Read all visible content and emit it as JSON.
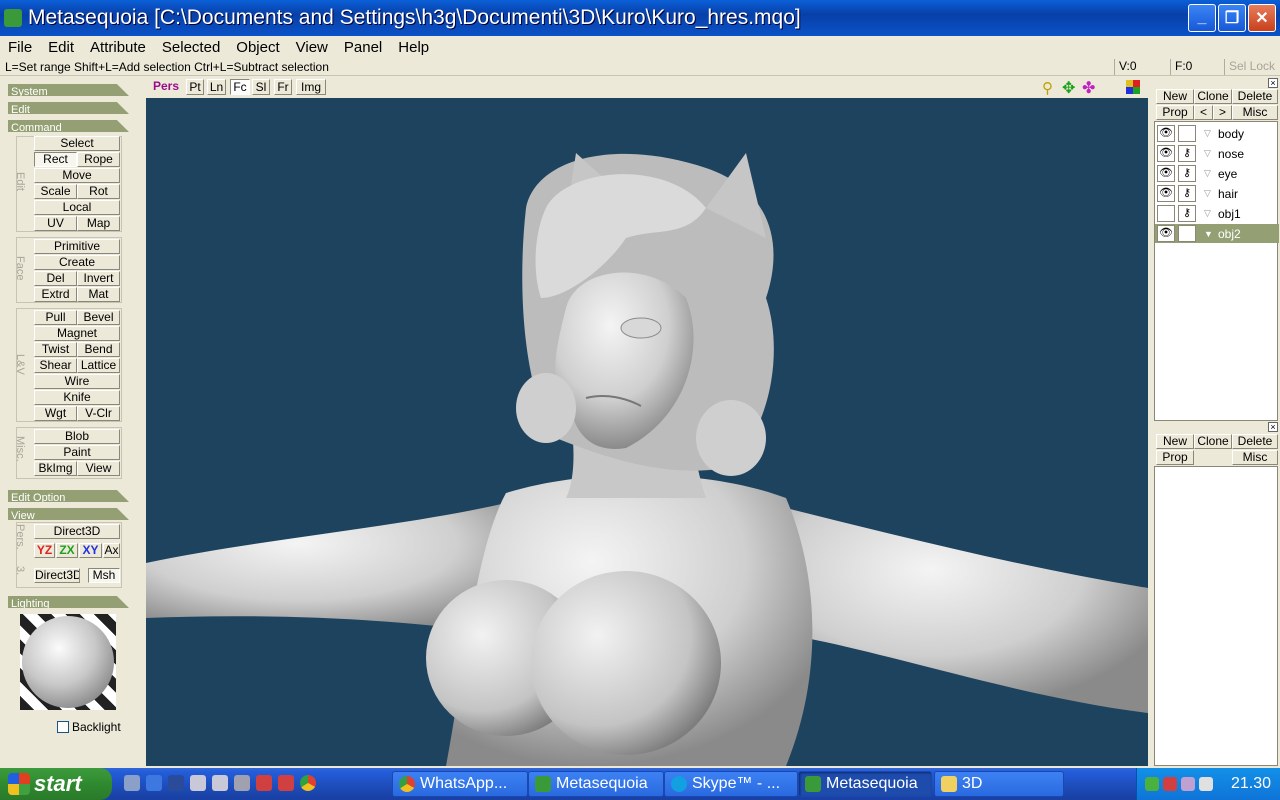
{
  "window": {
    "title": "Metasequoia [C:\\Documents and Settings\\h3g\\Documenti\\3D\\Kuro\\Kuro_hres.mqo]",
    "minimize": "_",
    "maximize": "❐",
    "close": "✕"
  },
  "menu": [
    "File",
    "Edit",
    "Attribute",
    "Selected",
    "Object",
    "View",
    "Panel",
    "Help"
  ],
  "status": {
    "hint": "L=Set range  Shift+L=Add selection  Ctrl+L=Subtract selection",
    "v": "V:0",
    "f": "F:0",
    "sel_lock": "Sel Lock"
  },
  "left": {
    "sections": {
      "system": "System",
      "edit": "Edit",
      "command": "Command",
      "edit_option": "Edit Option",
      "view": "View",
      "lighting": "Lighting"
    },
    "group_labels": {
      "edit": "Edit",
      "face": "Face",
      "lv": "L&V",
      "misc": "Misc.",
      "pers": "Pers.",
      "three": "3."
    },
    "buttons": {
      "select": "Select",
      "rect": "Rect",
      "rope": "Rope",
      "move": "Move",
      "scale": "Scale",
      "rot": "Rot",
      "local": "Local",
      "uv": "UV",
      "map": "Map",
      "primitive": "Primitive",
      "create": "Create",
      "del": "Del",
      "invert": "Invert",
      "extrd": "Extrd",
      "mat": "Mat",
      "pull": "Pull",
      "bevel": "Bevel",
      "magnet": "Magnet",
      "twist": "Twist",
      "bend": "Bend",
      "shear": "Shear",
      "lattice": "Lattice",
      "wire": "Wire",
      "knife": "Knife",
      "wgt": "Wgt",
      "vclr": "V-Clr",
      "blob": "Blob",
      "paint": "Paint",
      "bkimg": "BkImg",
      "view": "View",
      "direct3d": "Direct3D",
      "yz": "YZ",
      "zx": "ZX",
      "xy": "XY",
      "ax": "Ax",
      "direct3d2": "Direct3D",
      "msh": "Msh"
    },
    "backlight": "Backlight"
  },
  "viewport": {
    "buttons": [
      "Pers",
      "Pt",
      "Ln",
      "Fc",
      "Sl",
      "Fr",
      "Img"
    ],
    "active": "Fc",
    "background": "#1e435e"
  },
  "right": {
    "object_buttons": {
      "new": "New",
      "clone": "Clone",
      "delete": "Delete",
      "prop": "Prop",
      "prev": "<",
      "next": ">",
      "misc": "Misc"
    },
    "objects": [
      {
        "name": "body",
        "visible": true,
        "locked": false,
        "selected": false
      },
      {
        "name": "nose",
        "visible": true,
        "locked": true,
        "selected": false
      },
      {
        "name": "eye",
        "visible": true,
        "locked": true,
        "selected": false
      },
      {
        "name": "hair",
        "visible": true,
        "locked": true,
        "selected": false
      },
      {
        "name": "obj1",
        "visible": false,
        "locked": true,
        "selected": false
      },
      {
        "name": "obj2",
        "visible": true,
        "locked": false,
        "selected": true
      }
    ],
    "material_buttons": {
      "new": "New",
      "clone": "Clone",
      "delete": "Delete",
      "prop": "Prop",
      "misc": "Misc"
    }
  },
  "taskbar": {
    "start": "start",
    "tasks": [
      {
        "label": "WhatsApp...",
        "icon": "chrome-icon",
        "active": false
      },
      {
        "label": "Metasequoia",
        "icon": "metasequoia-icon",
        "active": false
      },
      {
        "label": "Skype™ - ...",
        "icon": "skype-icon",
        "active": false
      },
      {
        "label": "Metasequoia",
        "icon": "metasequoia-icon",
        "active": true
      },
      {
        "label": "3D",
        "icon": "folder-icon",
        "active": false
      }
    ],
    "clock": "21.30"
  }
}
